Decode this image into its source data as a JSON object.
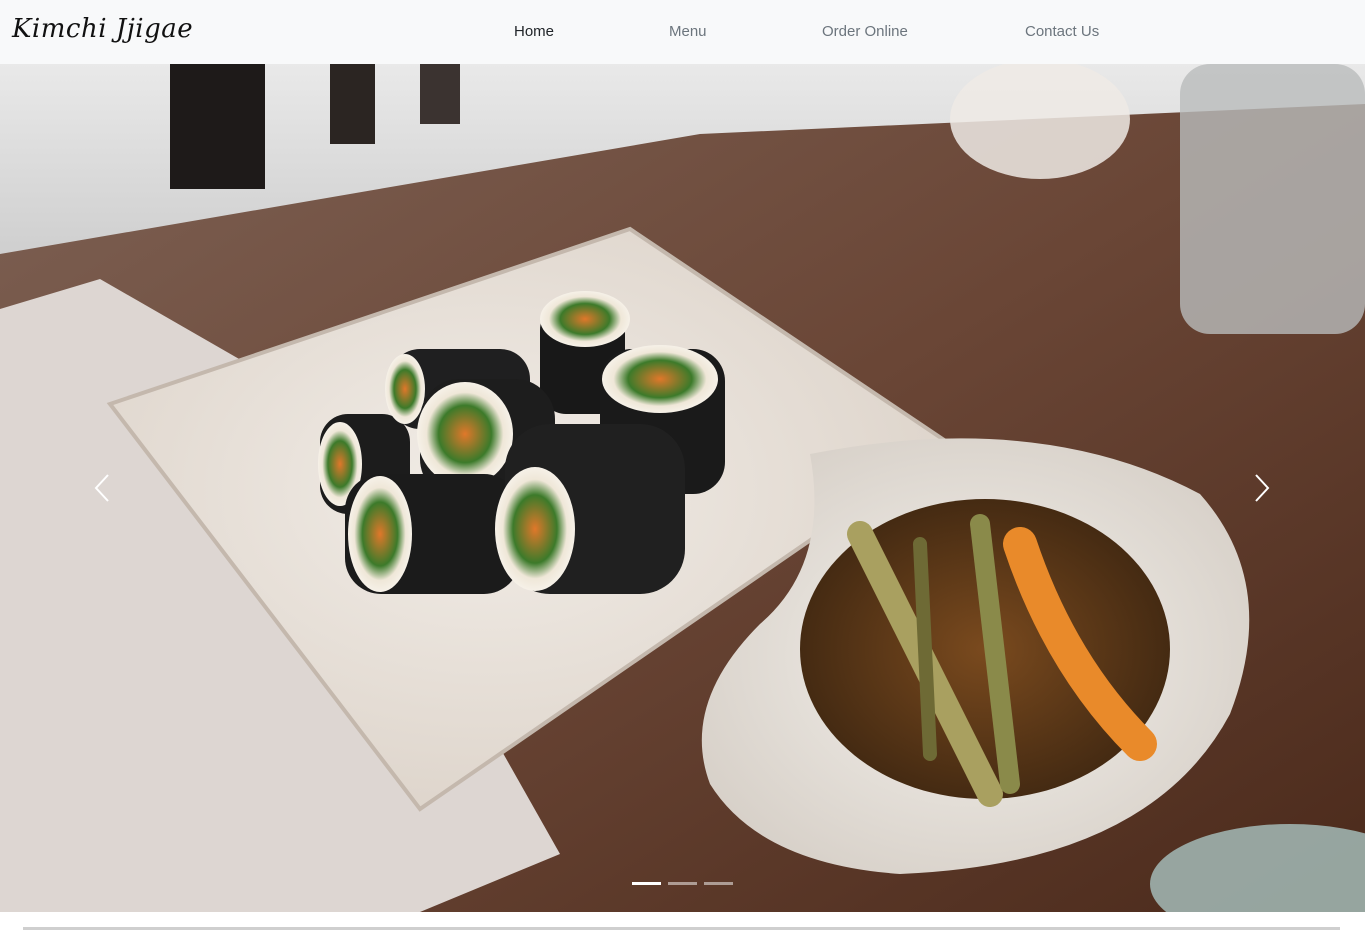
{
  "navbar": {
    "brand": "Kimchi Jjigae",
    "links": [
      {
        "label": "Home",
        "active": true
      },
      {
        "label": "Menu",
        "active": false
      },
      {
        "label": "Order Online",
        "active": false
      },
      {
        "label": "Contact Us",
        "active": false
      }
    ]
  },
  "carousel": {
    "slide_count": 3,
    "active_index": 0,
    "prev_icon": "chevron-left-icon",
    "next_icon": "chevron-right-icon",
    "image": "kimbap-and-kimchi-side-dish-photo"
  },
  "colors": {
    "navbar_bg": "#f8f9fa",
    "link": "#6c757d",
    "link_active": "#212529"
  }
}
